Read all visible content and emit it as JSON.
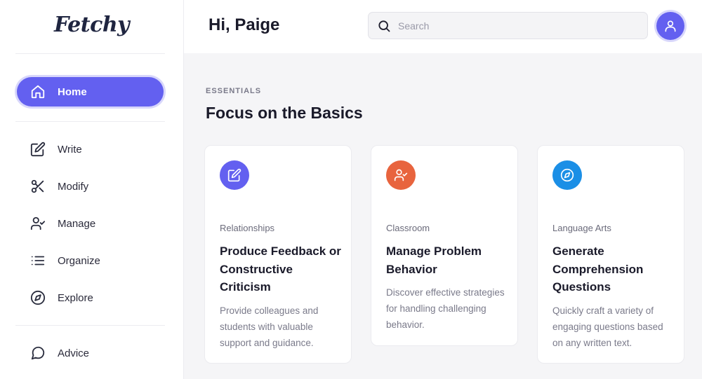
{
  "app": {
    "logo": "Fetchy"
  },
  "sidebar": {
    "items": [
      {
        "label": "Home",
        "icon": "home-icon"
      },
      {
        "label": "Write",
        "icon": "edit-icon"
      },
      {
        "label": "Modify",
        "icon": "scissors-icon"
      },
      {
        "label": "Manage",
        "icon": "user-check-icon"
      },
      {
        "label": "Organize",
        "icon": "list-icon"
      },
      {
        "label": "Explore",
        "icon": "compass-icon"
      },
      {
        "label": "Advice",
        "icon": "message-circle-icon"
      }
    ],
    "active": "Home"
  },
  "header": {
    "greeting": "Hi, Paige",
    "search": {
      "placeholder": "Search",
      "value": ""
    },
    "avatar_icon": "user-icon"
  },
  "main": {
    "eyebrow": "ESSENTIALS",
    "title": "Focus on the Basics",
    "cards": [
      {
        "icon": "edit-icon",
        "color": "#6360f0",
        "category": "Relationships",
        "title": "Produce Feedback or Constructive Criticism",
        "description": "Provide colleagues and students with valuable support and guidance."
      },
      {
        "icon": "user-check-icon",
        "color": "#e8643e",
        "category": "Classroom",
        "title": "Manage Problem Behavior",
        "description": "Discover effective strategies for handling challenging behavior."
      },
      {
        "icon": "compass-icon",
        "color": "#1b8fe6",
        "category": "Language Arts",
        "title": "Generate Comprehension Questions",
        "description": "Quickly craft a variety of engaging questions based on any written text."
      }
    ]
  },
  "colors": {
    "accent": "#6360f0",
    "accent_ring": "#d8d7fb"
  }
}
